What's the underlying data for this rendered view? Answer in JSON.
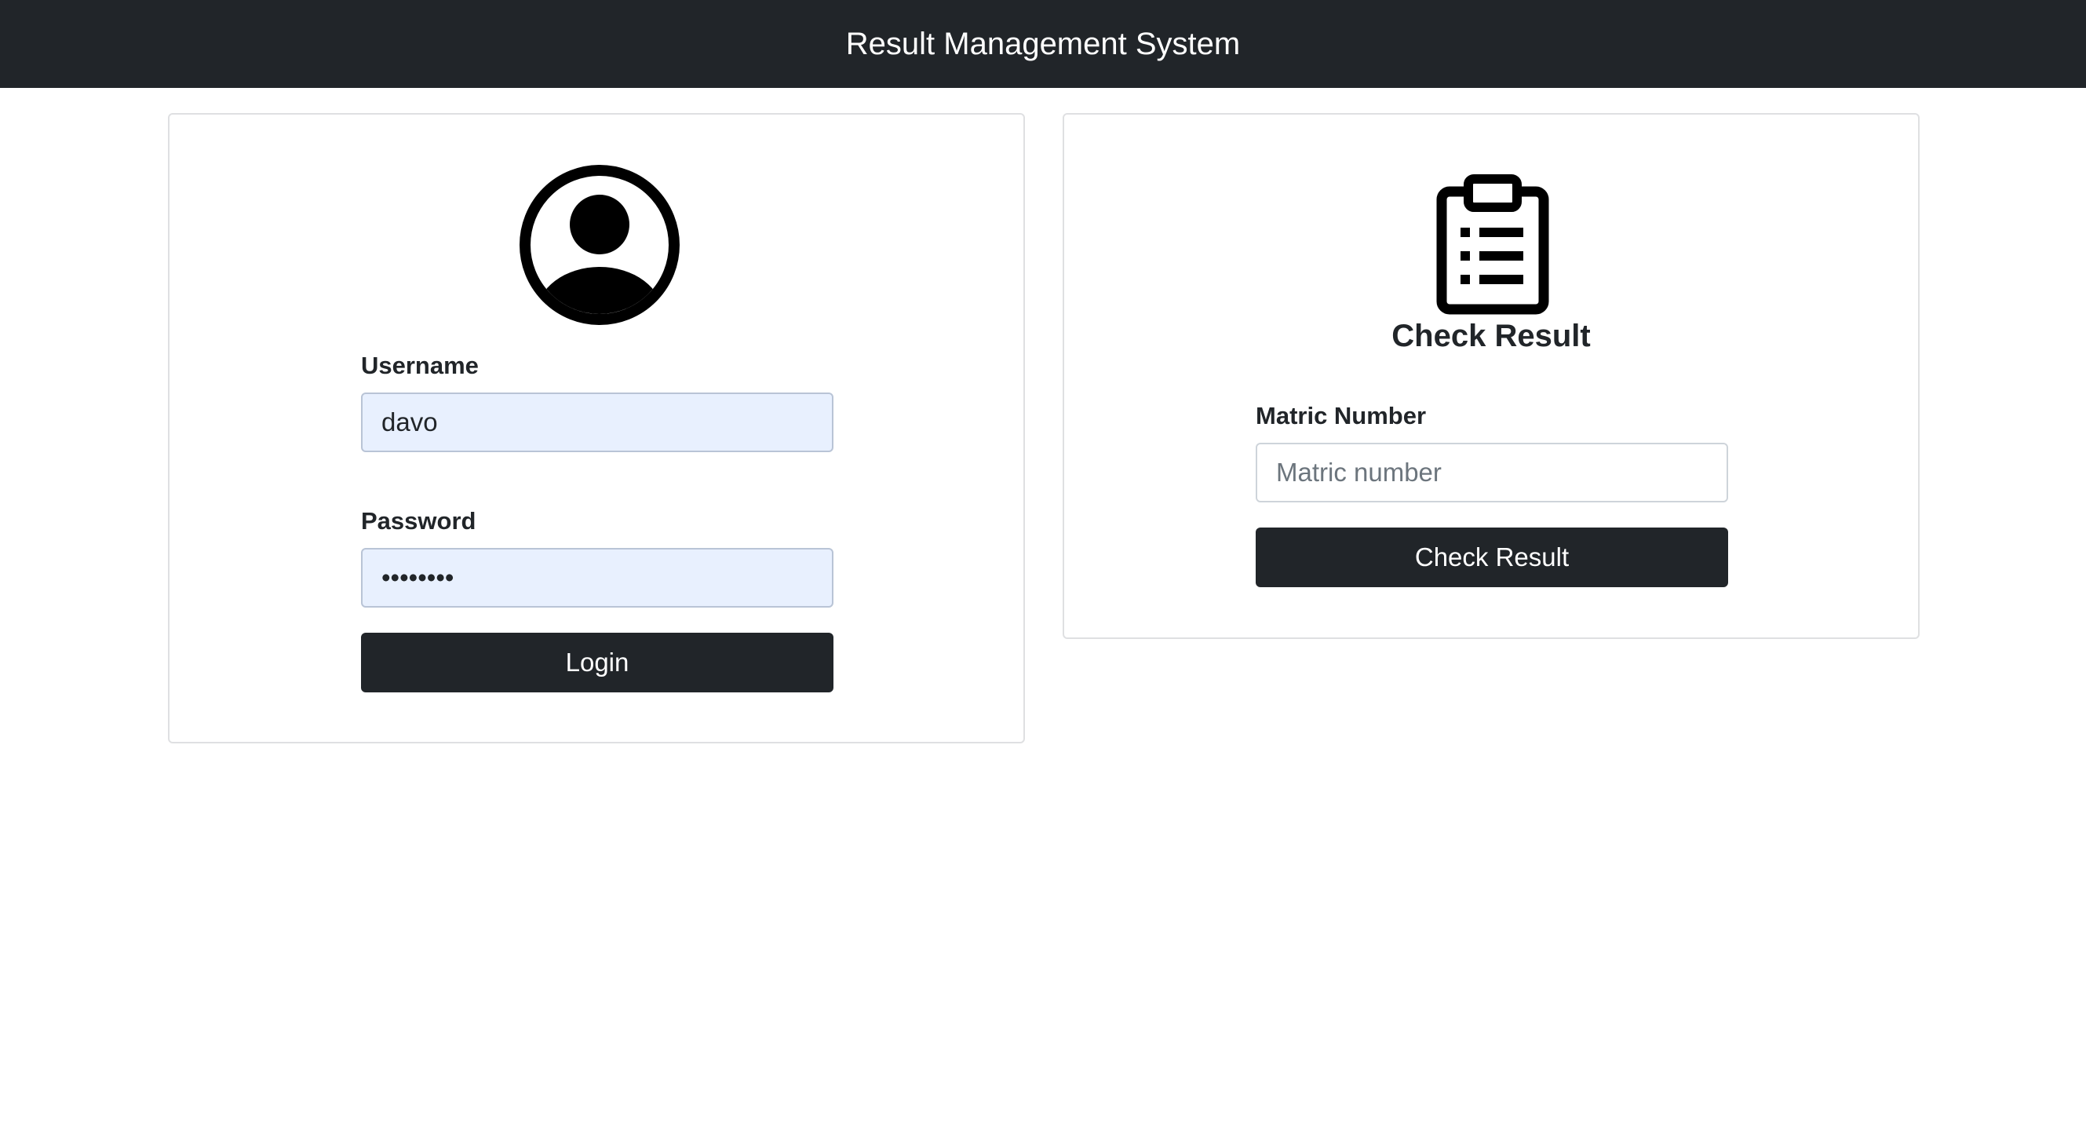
{
  "header": {
    "title": "Result Management System"
  },
  "login": {
    "avatar_icon": "user-circle-icon",
    "username_label": "Username",
    "username_value": "davo",
    "password_label": "Password",
    "password_value": "........",
    "login_button": "Login"
  },
  "result": {
    "icon": "clipboard-list-icon",
    "title": "Check Result",
    "matric_label": "Matric Number",
    "matric_placeholder": "Matric number",
    "check_button": "Check Result"
  },
  "colors": {
    "navbar": "#212529",
    "button": "#212529",
    "autofill": "#e8f0fe"
  }
}
